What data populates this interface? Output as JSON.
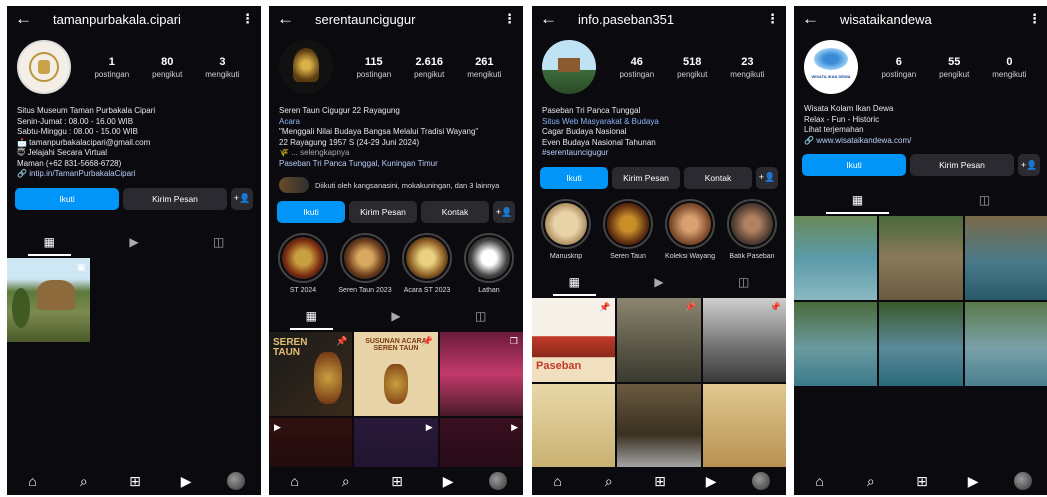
{
  "phones": [
    {
      "username": "tamanpurbakala.cipari",
      "stats": [
        {
          "num": "1",
          "label": "postingan"
        },
        {
          "num": "80",
          "label": "pengikut"
        },
        {
          "num": "3",
          "label": "mengikuti"
        }
      ],
      "bio": [
        "Situs Museum Taman Purbakala Cipari",
        "Senin-Jumat : 08.00 - 16.00 WIB",
        "Sabtu-Minggu : 08.00 - 15.00 WIB",
        "📩 tamanpurbakalacipari@gmail.com",
        "😇 Jelajahi Secara Virtual",
        "Maman (+62 831-5668-6728)"
      ],
      "link": "intip.in/TamanPurbakalaCipari",
      "buttons": {
        "follow": "Ikuti",
        "message": "Kirim Pesan"
      }
    },
    {
      "username": "serentauncigugur",
      "stats": [
        {
          "num": "115",
          "label": "postingan"
        },
        {
          "num": "2.616",
          "label": "pengikut"
        },
        {
          "num": "261",
          "label": "mengikuti"
        }
      ],
      "bio_title": "Seren Taun Cigugur 22 Rayagung",
      "bio_category": "Acara",
      "bio": [
        "\"Menggali Nilai Budaya Bangsa Melalui Tradisi Wayang\"",
        "22 Rayagung 1957 S (24-29 Juni 2024)",
        "🌾 ... selengkapnya"
      ],
      "location": "Paseban Tri Panca Tunggal, Kuningan Timur",
      "followed_by": "Diikuti oleh kangsanasini, mokakuningan, dan 3 lainnya",
      "buttons": {
        "follow": "Ikuti",
        "message": "Kirim Pesan",
        "contact": "Kontak"
      },
      "highlights": [
        "ST 2024",
        "Seren Taun 2023",
        "Acara ST 2023",
        "Lathan"
      ],
      "posts": [
        {
          "title": "SEREN TAUN"
        },
        {
          "title": "SUSUNAN ACARA SEREN TAUN"
        },
        {
          "title": ""
        }
      ]
    },
    {
      "username": "info.paseban351",
      "stats": [
        {
          "num": "46",
          "label": "postingan"
        },
        {
          "num": "518",
          "label": "pengikut"
        },
        {
          "num": "23",
          "label": "mengikuti"
        }
      ],
      "bio_title": "Paseban Tri Panca Tunggal",
      "bio_category": "Situs Web Masyarakat & Budaya",
      "bio": [
        "Cagar Budaya Nasional",
        "Even Budaya Nasional Tahunan",
        "#serentauncigugur"
      ],
      "buttons": {
        "follow": "Ikuti",
        "message": "Kirim Pesan",
        "contact": "Kontak"
      },
      "highlights": [
        "Manuskrip",
        "Seren Taun",
        "Koleksi Wayang",
        "Batik Paseban"
      ],
      "post_label": "Paseban"
    },
    {
      "username": "wisataikandewa",
      "stats": [
        {
          "num": "6",
          "label": "postingan"
        },
        {
          "num": "55",
          "label": "pengikut"
        },
        {
          "num": "0",
          "label": "mengikuti"
        }
      ],
      "bio": [
        "Wisata Kolam Ikan Dewa",
        "Relax - Fun - Historic",
        "Lihat terjemahan"
      ],
      "link": "www.wisataikandewa.com/",
      "avatar_text": "WISATA IKAN DEWA",
      "buttons": {
        "follow": "Ikuti",
        "message": "Kirim Pesan"
      }
    }
  ],
  "colors": {
    "background": "#0b0b0f",
    "accent": "#0095f6",
    "secondary_button": "#2a2a30",
    "link": "#8ab4f8"
  }
}
